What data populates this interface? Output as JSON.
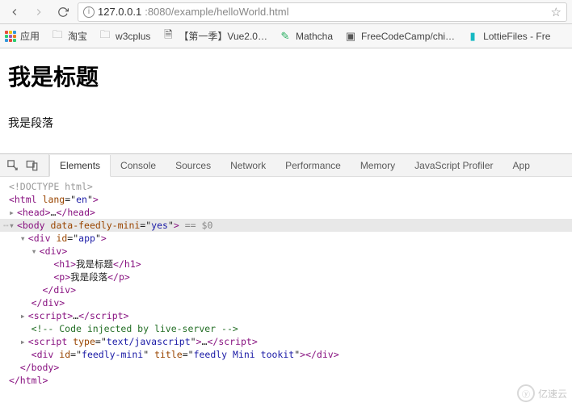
{
  "browser": {
    "url_host": "127.0.0.1",
    "url_port_path": ":8080/example/helloWorld.html"
  },
  "bookmarks": {
    "apps": "应用",
    "taobao": "淘宝",
    "w3cplus": "w3cplus",
    "vue": "【第一季】Vue2.0…",
    "mathcha": "Mathcha",
    "fcc": "FreeCodeCamp/chi…",
    "lottie": "LottieFiles - Fre"
  },
  "page": {
    "heading": "我是标题",
    "paragraph": "我是段落"
  },
  "devtools": {
    "tabs": {
      "elements": "Elements",
      "console": "Console",
      "sources": "Sources",
      "network": "Network",
      "performance": "Performance",
      "memory": "Memory",
      "jsprofiler": "JavaScript Profiler",
      "app": "App"
    }
  },
  "dom": {
    "doctype": "<!DOCTYPE html>",
    "html_open": "html",
    "html_lang_attr": "lang",
    "html_lang_val": "en",
    "head": "head",
    "body": "body",
    "body_attr": "data-feedly-mini",
    "body_attr_val": "yes",
    "eq_dollar": " == $0",
    "div": "div",
    "id_attr": "id",
    "app_val": "app",
    "h1": "h1",
    "h1_text": "我是标题",
    "p": "p",
    "p_text": "我是段落",
    "script": "script",
    "type_attr": "type",
    "type_val": "text/javascript",
    "comment": "<!-- Code injected by live-server -->",
    "feedly_id": "feedly-mini",
    "title_attr": "title",
    "title_val": "feedly Mini tookit"
  },
  "watermark": "亿速云"
}
